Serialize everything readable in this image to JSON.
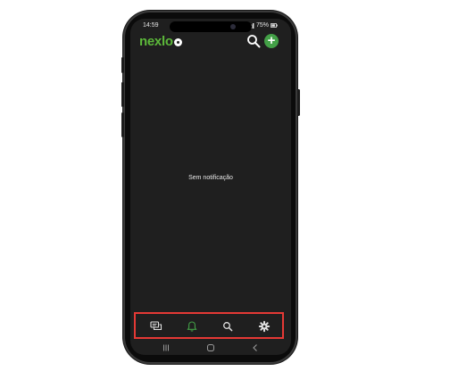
{
  "status_bar": {
    "time": "14:59",
    "battery": "75%"
  },
  "app": {
    "logo_text": "nexlo"
  },
  "main": {
    "empty_message": "Sem notificação"
  },
  "bottom_nav": {
    "items": [
      {
        "icon": "chat-icon",
        "active": false
      },
      {
        "icon": "bell-icon",
        "active": true
      },
      {
        "icon": "search-icon",
        "active": false
      },
      {
        "icon": "gear-icon",
        "active": false
      }
    ]
  },
  "system_nav": {
    "items": [
      "recents-icon",
      "home-icon",
      "back-icon"
    ]
  },
  "colors": {
    "brand": "#5cb83a",
    "add_button": "#43a047",
    "active_icon": "#43a047",
    "highlight": "#e53935",
    "screen_bg": "#1f1f1f"
  }
}
